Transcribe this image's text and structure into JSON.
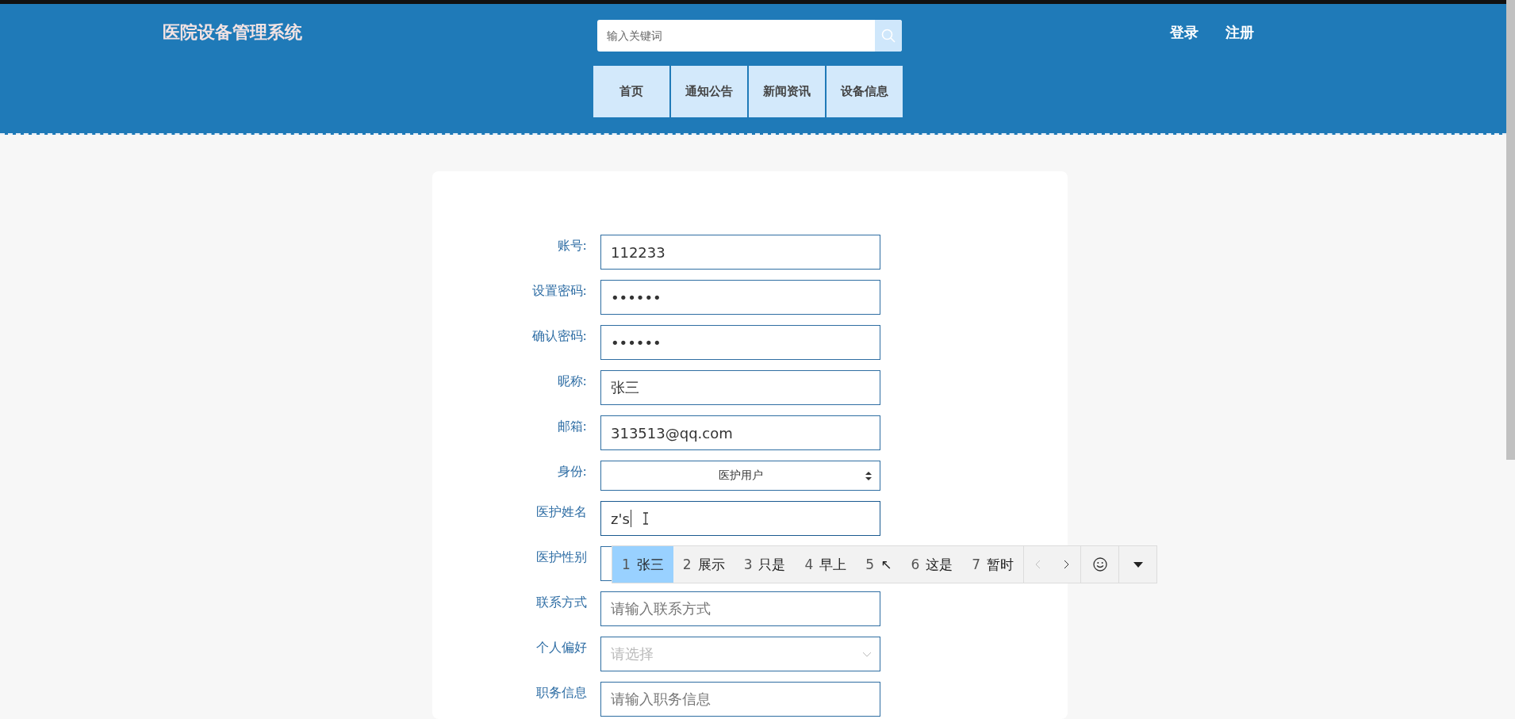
{
  "header": {
    "title": "医院设备管理系统",
    "search": {
      "placeholder": "输入关键词"
    },
    "nav": [
      {
        "label": "首页"
      },
      {
        "label": "通知公告"
      },
      {
        "label": "新闻资讯"
      },
      {
        "label": "设备信息"
      }
    ],
    "links": [
      "登录",
      "注册"
    ]
  },
  "form": {
    "fields": [
      {
        "label": "账号:",
        "kind": "text",
        "value": "112233"
      },
      {
        "label": "设置密码:",
        "kind": "password",
        "value": "••••••"
      },
      {
        "label": "确认密码:",
        "kind": "password",
        "value": "••••••"
      },
      {
        "label": "昵称:",
        "kind": "text",
        "value": "张三"
      },
      {
        "label": "邮箱:",
        "kind": "text",
        "value": "313513@qq.com"
      },
      {
        "label": "身份:",
        "kind": "select",
        "value": "医护用户"
      },
      {
        "label": "医护姓名",
        "kind": "text",
        "value": "z's",
        "focused": true
      },
      {
        "label": "医护性别",
        "kind": "dropdown"
      },
      {
        "label": "联系方式",
        "kind": "text",
        "placeholder": "请输入联系方式"
      },
      {
        "label": "个人偏好",
        "kind": "picker",
        "placeholder": "请选择"
      },
      {
        "label": "职务信息",
        "kind": "text",
        "placeholder": "请输入职务信息"
      }
    ]
  },
  "ime": {
    "candidates": [
      {
        "index": "1",
        "text": "张三",
        "selected": true
      },
      {
        "index": "2",
        "text": "展示",
        "selected": false
      },
      {
        "index": "3",
        "text": "只是",
        "selected": false
      },
      {
        "index": "4",
        "text": "早上",
        "selected": false
      },
      {
        "index": "5",
        "text": "↖",
        "selected": false
      },
      {
        "index": "6",
        "text": "这是",
        "selected": false
      },
      {
        "index": "7",
        "text": "暂时",
        "selected": false
      }
    ],
    "prev_disabled": true
  }
}
